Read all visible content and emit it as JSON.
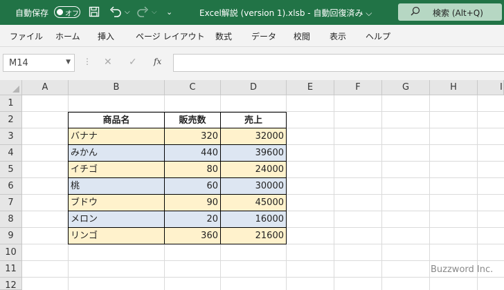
{
  "titlebar": {
    "autosave_label": "自動保存",
    "autosave_state": "オフ",
    "save_icon": "save-icon",
    "undo_icon": "undo-icon",
    "redo_icon": "redo-icon",
    "customize_icon": "customize-icon",
    "filename": "Excel解説 (version 1).xlsb  -  自動回復済み ⌵",
    "search_placeholder": "検索 (Alt+Q)",
    "bar_color": "#217346"
  },
  "ribbon": {
    "tabs": [
      "ファイル",
      "ホーム",
      "挿入",
      "ページ レイアウト",
      "数式",
      "データ",
      "校閲",
      "表示",
      "ヘルプ"
    ]
  },
  "formula_bar": {
    "name_box": "M14",
    "formula": ""
  },
  "sheet": {
    "columns": [
      "A",
      "B",
      "C",
      "D",
      "E",
      "F",
      "G",
      "H",
      "I"
    ],
    "rows": [
      "1",
      "2",
      "3",
      "4",
      "5",
      "6",
      "7",
      "8",
      "9",
      "10",
      "11",
      "12"
    ],
    "table": {
      "headers": [
        "商品名",
        "販売数",
        "売上"
      ],
      "rows": [
        [
          "バナナ",
          "320",
          "32000"
        ],
        [
          "みかん",
          "440",
          "39600"
        ],
        [
          "イチゴ",
          "80",
          "24000"
        ],
        [
          "桃",
          "60",
          "30000"
        ],
        [
          "ブドウ",
          "90",
          "45000"
        ],
        [
          "メロン",
          "20",
          "16000"
        ],
        [
          "リンゴ",
          "360",
          "21600"
        ]
      ],
      "band_colors": [
        "#fff2cc",
        "#dde6f2"
      ]
    }
  },
  "watermark": "Buzzword Inc."
}
